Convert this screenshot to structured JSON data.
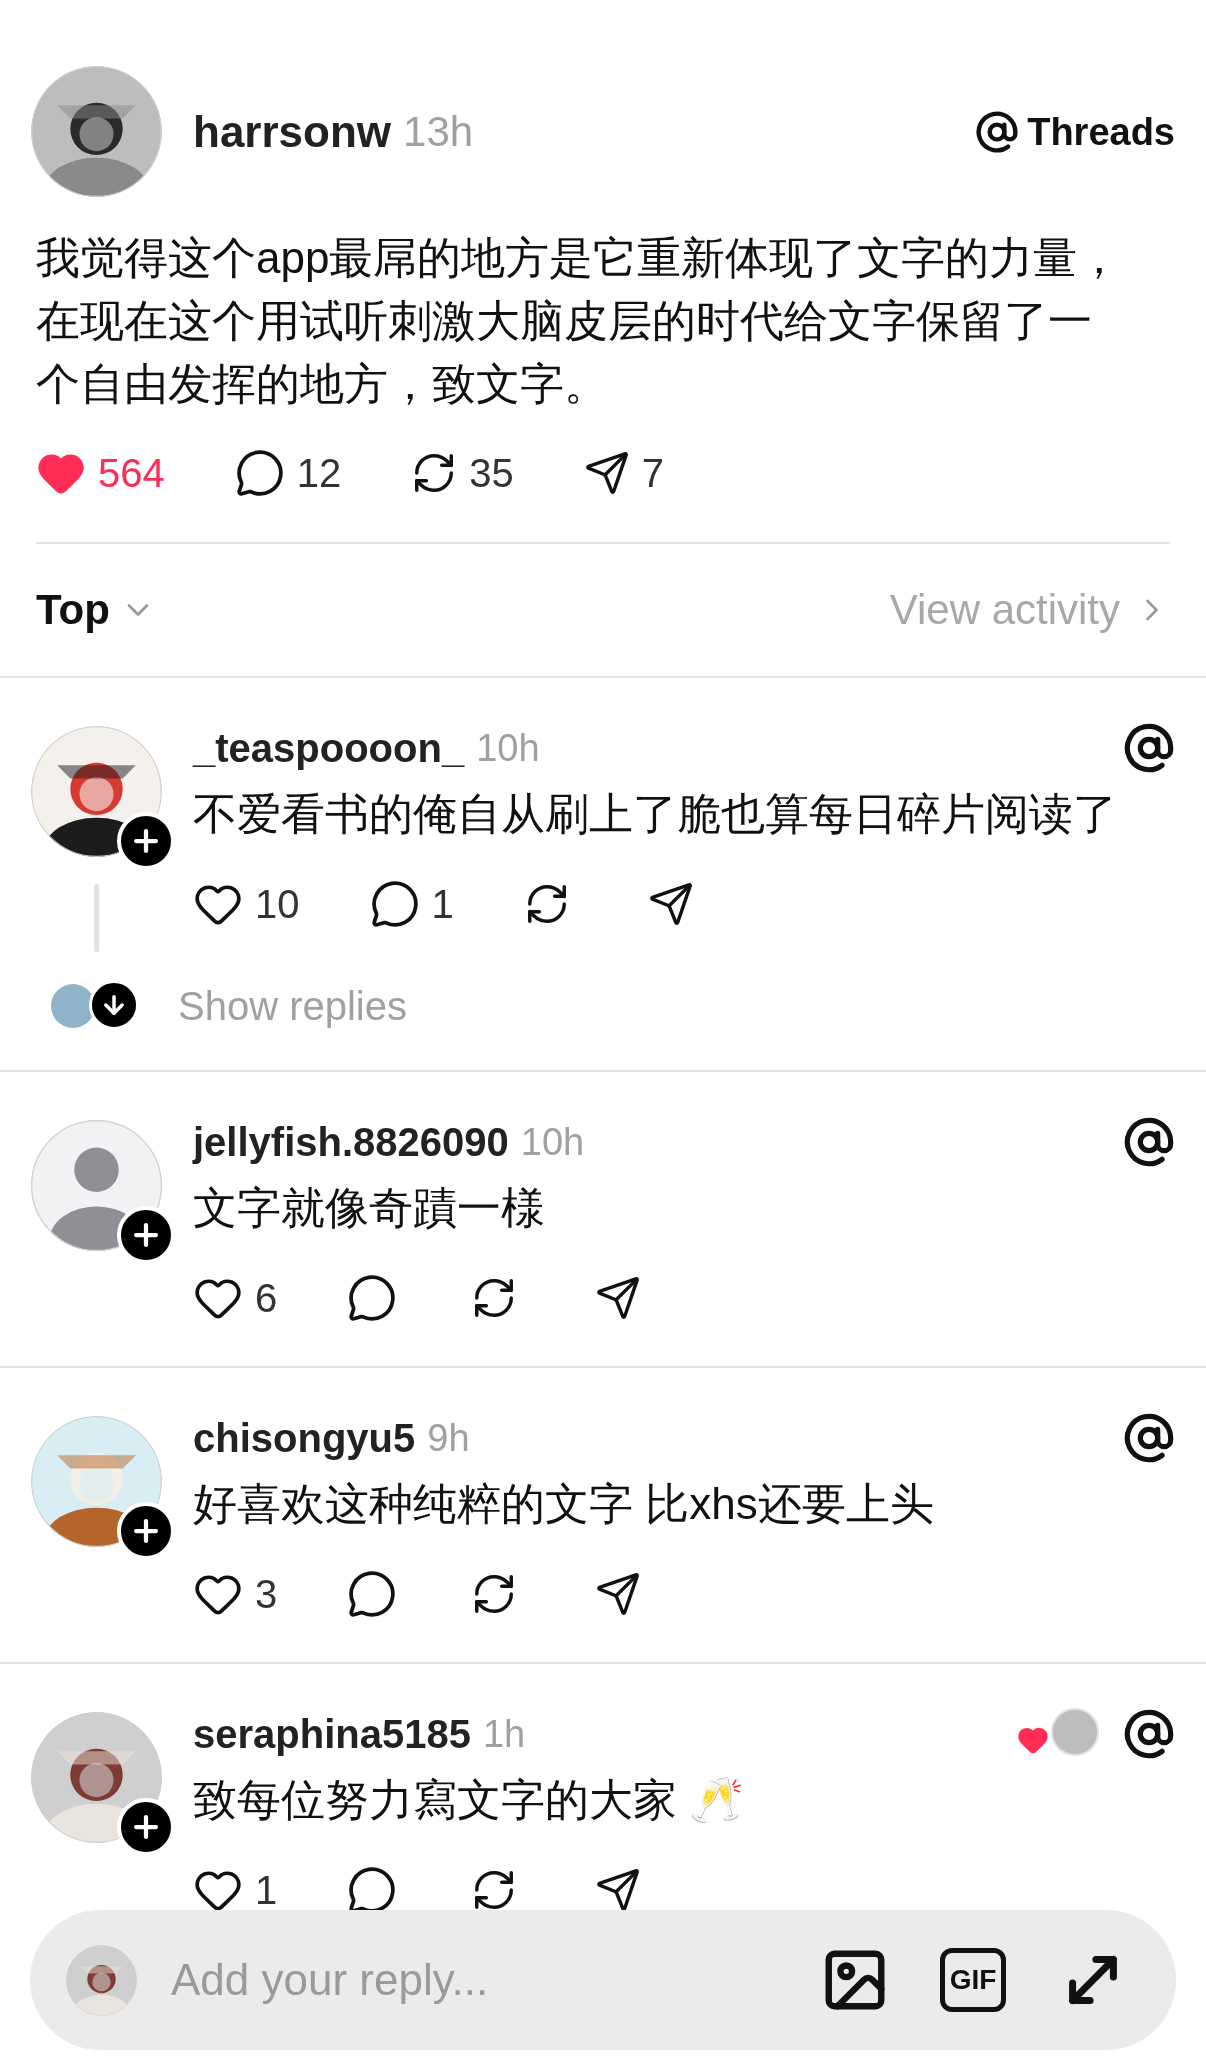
{
  "post": {
    "author": "harrsonw",
    "time": "13h",
    "source": "Threads",
    "text": "我觉得这个app最屌的地方是它重新体现了文字的力量，在现在这个用试听刺激大脑皮层的时代给文字保留了一个自由发挥的地方，致文字。",
    "liked": true,
    "stats": [
      {
        "kind": "like",
        "count": "564"
      },
      {
        "kind": "comment",
        "count": "12"
      },
      {
        "kind": "repost",
        "count": "35"
      },
      {
        "kind": "share",
        "count": "7"
      }
    ]
  },
  "sort": {
    "label": "Top",
    "link": "View activity"
  },
  "comments": [
    {
      "author": "_teaspoooon_",
      "time": "10h",
      "text": "不爱看书的俺自从刷上了脆也算每日碎片阅读了",
      "kind": "picture",
      "liked": false,
      "liked_by_author": false,
      "stats": [
        {
          "kind": "like",
          "count": "10"
        },
        {
          "kind": "comment",
          "count": "1"
        },
        {
          "kind": "repost"
        },
        {
          "kind": "share"
        }
      ],
      "replies": {
        "label": "Show replies"
      }
    },
    {
      "author": "jellyfish.8826090",
      "time": "10h",
      "text": "文字就像奇蹟一様",
      "kind": "default",
      "liked": false,
      "liked_by_author": false,
      "stats": [
        {
          "kind": "like",
          "count": "6"
        },
        {
          "kind": "comment"
        },
        {
          "kind": "repost"
        },
        {
          "kind": "share"
        }
      ]
    },
    {
      "author": "chisongyu5",
      "time": "9h",
      "text": "好喜欢这种纯粹的文字 比xhs还要上头",
      "kind": "picture",
      "liked": false,
      "liked_by_author": false,
      "stats": [
        {
          "kind": "like",
          "count": "3"
        },
        {
          "kind": "comment"
        },
        {
          "kind": "repost"
        },
        {
          "kind": "share"
        }
      ]
    },
    {
      "author": "seraphina5185",
      "time": "1h",
      "text": "致每位努力寫文字的大家 🥂",
      "kind": "picture",
      "liked": false,
      "liked_by_author": true,
      "stats": [
        {
          "kind": "like",
          "count": "1"
        },
        {
          "kind": "comment"
        },
        {
          "kind": "repost"
        },
        {
          "kind": "share"
        }
      ]
    }
  ],
  "reply_bar": {
    "placeholder": "Add your reply...",
    "gif": "GIF"
  }
}
